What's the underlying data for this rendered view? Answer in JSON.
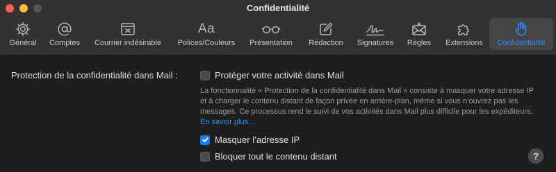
{
  "window": {
    "title": "Confidentialité"
  },
  "toolbar": {
    "tabs": [
      {
        "label": "Général",
        "icon": "gear-icon"
      },
      {
        "label": "Comptes",
        "icon": "at-sign-icon"
      },
      {
        "label": "Courrier indésirable",
        "icon": "junk-tray-icon"
      },
      {
        "label": "Polices/Couleurs",
        "icon": "font-aa-icon"
      },
      {
        "label": "Présentation",
        "icon": "glasses-icon"
      },
      {
        "label": "Rédaction",
        "icon": "compose-icon"
      },
      {
        "label": "Signatures",
        "icon": "signature-icon"
      },
      {
        "label": "Règles",
        "icon": "rules-envelope-icon"
      },
      {
        "label": "Extensions",
        "icon": "puzzle-icon"
      },
      {
        "label": "Confidentialité",
        "icon": "hand-icon",
        "active": true
      }
    ]
  },
  "privacy": {
    "section_label": "Protection de la confidentialité dans Mail :",
    "protect_activity": {
      "label": "Protéger votre activité dans Mail",
      "checked": false
    },
    "description": "La fonctionnalité « Protection de la confidentialité dans Mail » consiste à masquer votre adresse IP et à charger le contenu distant de façon privée en arrière-plan, même si vous n’ouvrez pas les messages. Ce processus rend le suivi de vos activités dans Mail plus difficile pour les expéditeurs.",
    "learn_more": "En savoir plus…",
    "hide_ip": {
      "label": "Masquer l’adresse IP",
      "checked": true
    },
    "block_remote": {
      "label": "Bloquer tout le contenu distant",
      "checked": false
    }
  },
  "help": {
    "label": "?"
  },
  "colors": {
    "accent": "#2f8bff",
    "checkbox_checked": "#1a7cf5",
    "titlebar": "#323232",
    "background": "#1e1e1e"
  }
}
